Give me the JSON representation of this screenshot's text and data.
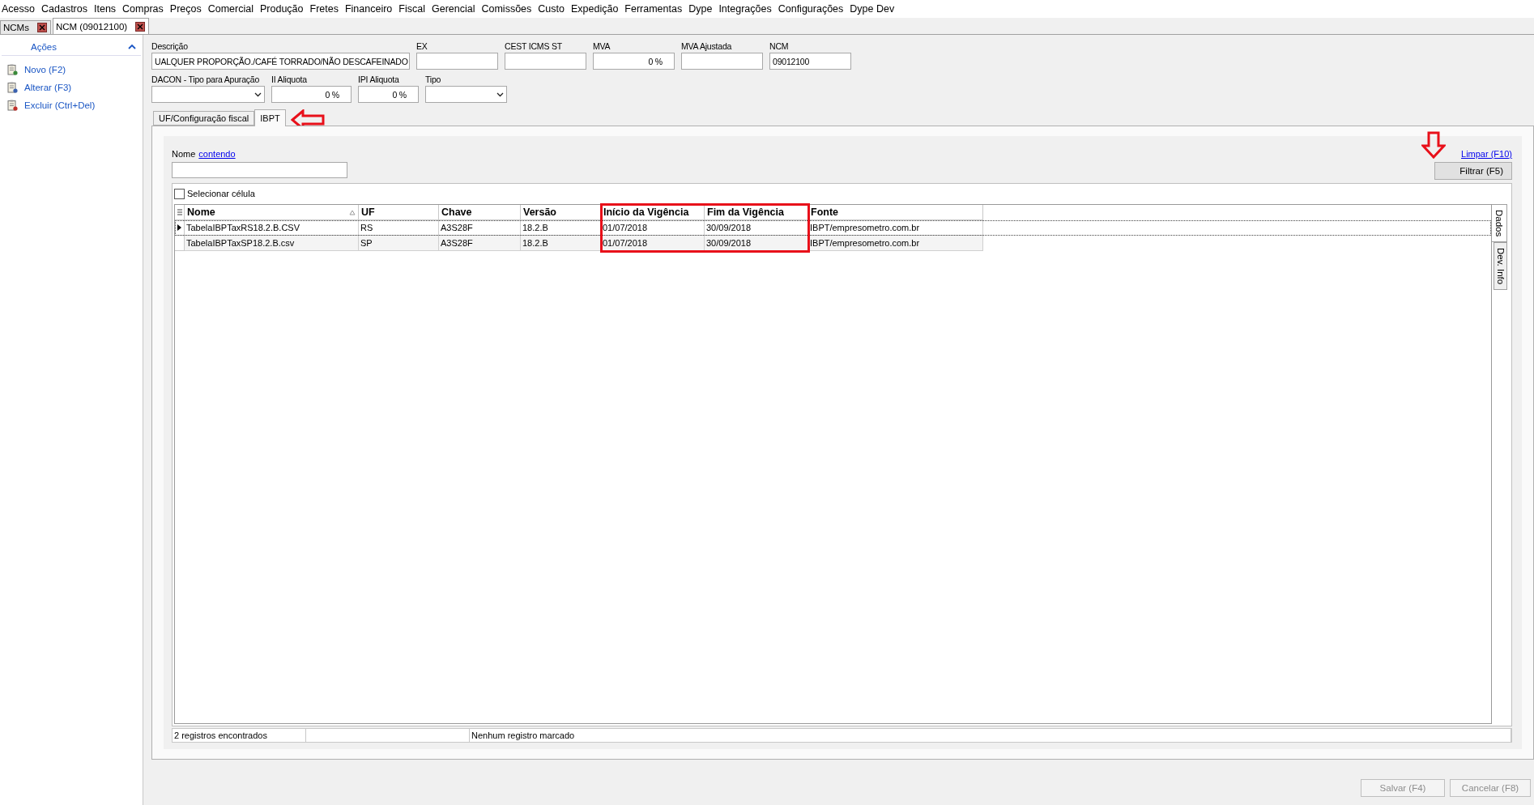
{
  "menu": [
    "Acesso",
    "Cadastros",
    "Itens",
    "Compras",
    "Preços",
    "Comercial",
    "Produção",
    "Fretes",
    "Financeiro",
    "Fiscal",
    "Gerencial",
    "Comissões",
    "Custo",
    "Expedição",
    "Ferramentas",
    "Dype",
    "Integrações",
    "Configurações",
    "Dype Dev"
  ],
  "doc_tabs": [
    {
      "label": "NCMs",
      "selected": false
    },
    {
      "label": "NCM (09012100)",
      "selected": true
    }
  ],
  "sidebar": {
    "title": "Ações",
    "expanded": true,
    "items": [
      {
        "label": "Novo (F2)",
        "kind": "new"
      },
      {
        "label": "Alterar (F3)",
        "kind": "edit"
      },
      {
        "label": "Excluir (Ctrl+Del)",
        "kind": "delete"
      }
    ]
  },
  "form_rows": [
    [
      {
        "label": "Descrição",
        "value": "UALQUER PROPORÇÃO./CAFÉ TORRADO/NÃO DESCAFEINADO",
        "kind": "text"
      },
      {
        "label": "EX",
        "kind": "text"
      },
      {
        "label": "CEST ICMS ST",
        "kind": "text"
      },
      {
        "label": "MVA",
        "value": "0 %",
        "kind": "number"
      },
      {
        "label": "MVA Ajustada",
        "kind": "text"
      },
      {
        "label": "NCM",
        "value": "09012100",
        "kind": "text"
      }
    ],
    [
      {
        "label": "DACON - Tipo para Apuração",
        "kind": "select"
      },
      {
        "label": "II Aliquota",
        "value": "0 %",
        "kind": "number"
      },
      {
        "label": "IPI Aliquota",
        "value": "0 %",
        "kind": "number"
      },
      {
        "label": "Tipo",
        "kind": "select"
      }
    ]
  ],
  "tabs": [
    {
      "label": "UF/Configuração fiscal",
      "selected": false
    },
    {
      "label": "IBPT",
      "selected": true
    }
  ],
  "filter": {
    "label": "Nome",
    "operator": "contendo",
    "clear_link": "Limpar (F10)",
    "button": "Filtrar (F5)"
  },
  "grid": {
    "select_cell": {
      "label": "Selecionar célula",
      "checked": false
    },
    "columns": [
      {
        "label": "Nome",
        "sorted": true,
        "highlighted": false
      },
      {
        "label": "UF",
        "sorted": false,
        "highlighted": false
      },
      {
        "label": "Chave",
        "sorted": false,
        "highlighted": false
      },
      {
        "label": "Versão",
        "sorted": false,
        "highlighted": false
      },
      {
        "label": "Início da Vigência",
        "sorted": false,
        "highlighted": true
      },
      {
        "label": "Fim da Vigência",
        "sorted": false,
        "highlighted": true
      },
      {
        "label": "Fonte",
        "sorted": false,
        "highlighted": false
      }
    ],
    "rows": [
      {
        "selected": true,
        "cells": [
          "TabelaIBPTaxRS18.2.B.CSV",
          "RS",
          "A3S28F",
          "18.2.B",
          "01/07/2018",
          "30/09/2018",
          "IBPT/empresometro.com.br"
        ]
      },
      {
        "selected": false,
        "cells": [
          "TabelaIBPTaxSP18.2.B.csv",
          "SP",
          "A3S28F",
          "18.2.B",
          "01/07/2018",
          "30/09/2018",
          "IBPT/empresometro.com.br"
        ]
      }
    ],
    "side_tabs": [
      {
        "label": "Dados",
        "selected": true
      },
      {
        "label": "Dev. Info",
        "selected": false
      }
    ]
  },
  "status_bar": {
    "count": "2 registros encontrados",
    "marked": "Nenhum registro marcado"
  },
  "buttons": [
    {
      "label": "Salvar (F4)",
      "disabled": true
    },
    {
      "label": "Cancelar (F8)",
      "disabled": true
    }
  ]
}
